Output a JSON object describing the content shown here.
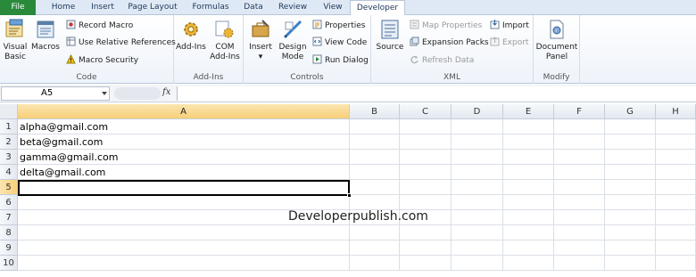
{
  "ribbon_tabs": [
    "File",
    "Home",
    "Insert",
    "Page Layout",
    "Formulas",
    "Data",
    "Review",
    "View",
    "Developer"
  ],
  "groups": {
    "code": {
      "label": "Code",
      "visual_basic": "Visual Basic",
      "macros": "Macros",
      "record_macro": "Record Macro",
      "use_relative": "Use Relative References",
      "macro_security": "Macro Security"
    },
    "addins": {
      "label": "Add-Ins",
      "add_ins": "Add-Ins",
      "com_add_ins": "COM Add-Ins"
    },
    "controls": {
      "label": "Controls",
      "insert": "Insert",
      "design_mode": "Design Mode",
      "properties": "Properties",
      "view_code": "View Code",
      "run_dialog": "Run Dialog"
    },
    "xml": {
      "label": "XML",
      "source": "Source",
      "map_properties": "Map Properties",
      "expansion_packs": "Expansion Packs",
      "refresh_data": "Refresh Data",
      "import": "Import",
      "export": "Export"
    },
    "modify": {
      "label": "Modify",
      "document_panel": "Document Panel"
    }
  },
  "formula_bar": {
    "name_box": "A5",
    "fx": "fx",
    "value": ""
  },
  "columns": [
    "A",
    "B",
    "C",
    "D",
    "E",
    "F",
    "G",
    "H"
  ],
  "rows": [
    "1",
    "2",
    "3",
    "4",
    "5",
    "6",
    "7",
    "8",
    "9",
    "10"
  ],
  "cells": {
    "A1": "alpha@gmail.com",
    "A2": "beta@gmail.com",
    "A3": "gamma@gmail.com",
    "A4": "delta@gmail.com"
  },
  "watermark": "Developerpublish.com",
  "colors": {
    "file_tab": "#2a8a3b",
    "selection_header": "#f7cf78",
    "ribbon_text": "#1e395b"
  }
}
